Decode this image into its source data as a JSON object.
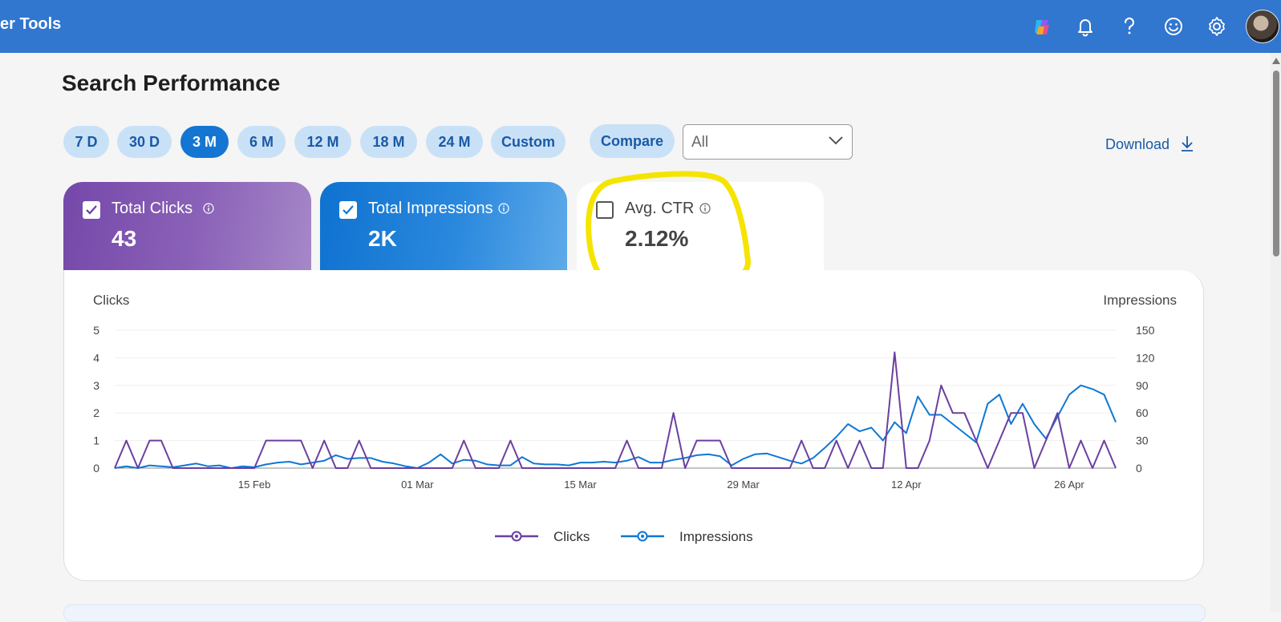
{
  "header": {
    "app_title": "er Tools",
    "icons": [
      "copilot-icon",
      "bell-icon",
      "help-icon",
      "smiley-icon",
      "gear-icon"
    ],
    "accent": "#3176cf"
  },
  "page": {
    "title": "Search Performance"
  },
  "ranges": [
    {
      "label": "7 D",
      "active": false
    },
    {
      "label": "30 D",
      "active": false
    },
    {
      "label": "3 M",
      "active": true
    },
    {
      "label": "6 M",
      "active": false
    },
    {
      "label": "12 M",
      "active": false
    },
    {
      "label": "18 M",
      "active": false
    },
    {
      "label": "24 M",
      "active": false
    },
    {
      "label": "Custom",
      "active": false
    }
  ],
  "compare": {
    "label": "Compare"
  },
  "filter": {
    "value": "All"
  },
  "download": {
    "label": "Download"
  },
  "metrics": {
    "clicks": {
      "label": "Total Clicks",
      "value": "43",
      "checked": true,
      "color": "#7a4fae"
    },
    "impressions": {
      "label": "Total Impressions",
      "value": "2K",
      "checked": true,
      "color": "#1476d2"
    },
    "ctr": {
      "label": "Avg. CTR",
      "value": "2.12%",
      "checked": false
    }
  },
  "chart_data": {
    "type": "line",
    "left_axis_label": "Clicks",
    "right_axis_label": "Impressions",
    "left_ticks": [
      "0",
      "1",
      "2",
      "3",
      "4",
      "5"
    ],
    "right_ticks": [
      "0",
      "30",
      "60",
      "90",
      "120",
      "150"
    ],
    "ylim_left": [
      0,
      5
    ],
    "ylim_right": [
      0,
      150
    ],
    "x_ticks": [
      "15 Feb",
      "01 Mar",
      "15 Mar",
      "29 Mar",
      "12 Apr",
      "26 Apr"
    ],
    "x": [
      "03 Feb",
      "04 Feb",
      "05 Feb",
      "06 Feb",
      "07 Feb",
      "08 Feb",
      "09 Feb",
      "10 Feb",
      "11 Feb",
      "12 Feb",
      "13 Feb",
      "14 Feb",
      "15 Feb",
      "16 Feb",
      "17 Feb",
      "18 Feb",
      "19 Feb",
      "20 Feb",
      "21 Feb",
      "22 Feb",
      "23 Feb",
      "24 Feb",
      "25 Feb",
      "26 Feb",
      "27 Feb",
      "28 Feb",
      "01 Mar",
      "02 Mar",
      "03 Mar",
      "04 Mar",
      "05 Mar",
      "06 Mar",
      "07 Mar",
      "08 Mar",
      "09 Mar",
      "10 Mar",
      "11 Mar",
      "12 Mar",
      "13 Mar",
      "14 Mar",
      "15 Mar",
      "16 Mar",
      "17 Mar",
      "18 Mar",
      "19 Mar",
      "20 Mar",
      "21 Mar",
      "22 Mar",
      "23 Mar",
      "24 Mar",
      "25 Mar",
      "26 Mar",
      "27 Mar",
      "28 Mar",
      "29 Mar",
      "30 Mar",
      "31 Mar",
      "01 Apr",
      "02 Apr",
      "03 Apr",
      "04 Apr",
      "05 Apr",
      "06 Apr",
      "07 Apr",
      "08 Apr",
      "09 Apr",
      "10 Apr",
      "11 Apr",
      "12 Apr",
      "13 Apr",
      "14 Apr",
      "15 Apr",
      "16 Apr",
      "17 Apr",
      "18 Apr",
      "19 Apr",
      "20 Apr",
      "21 Apr",
      "22 Apr",
      "23 Apr",
      "24 Apr",
      "25 Apr",
      "26 Apr",
      "27 Apr",
      "28 Apr",
      "29 Apr",
      "30 Apr"
    ],
    "series": [
      {
        "name": "Clicks",
        "axis": "left",
        "color": "#6b3fa0",
        "values": [
          0,
          1,
          0,
          1,
          1,
          0,
          0,
          0,
          0,
          0,
          0,
          0,
          0,
          1,
          1,
          1,
          1,
          0,
          1,
          0,
          0,
          1,
          0,
          0,
          0,
          0,
          0,
          0,
          0,
          0,
          1,
          0,
          0,
          0,
          1,
          0,
          0,
          0,
          0,
          0,
          0,
          0,
          0,
          0,
          1,
          0,
          0,
          0,
          2,
          0,
          1,
          1,
          1,
          0,
          0,
          0,
          0,
          0,
          0,
          1,
          0,
          0,
          1,
          0,
          1,
          0,
          0,
          4.2,
          0,
          0,
          1,
          3,
          2,
          2,
          1,
          0,
          1,
          2,
          2,
          0,
          1,
          2,
          0,
          1,
          0,
          1,
          0
        ]
      },
      {
        "name": "Impressions",
        "axis": "right",
        "color": "#0f78d4",
        "values": [
          0,
          2,
          0,
          3,
          2,
          1,
          3,
          5,
          2,
          3,
          0,
          2,
          1,
          4,
          6,
          7,
          4,
          6,
          8,
          14,
          10,
          11,
          11,
          7,
          5,
          2,
          0,
          6,
          15,
          5,
          9,
          8,
          4,
          3,
          3,
          12,
          5,
          4,
          4,
          3,
          6,
          6,
          7,
          6,
          8,
          12,
          6,
          6,
          9,
          11,
          14,
          15,
          13,
          3,
          10,
          15,
          16,
          12,
          8,
          5,
          11,
          22,
          34,
          48,
          40,
          44,
          30,
          50,
          38,
          78,
          58,
          58,
          48,
          38,
          28,
          70,
          80,
          48,
          70,
          48,
          32,
          56,
          80,
          90,
          86,
          80,
          50
        ]
      }
    ],
    "legend": "bottom-center",
    "grid": true
  }
}
